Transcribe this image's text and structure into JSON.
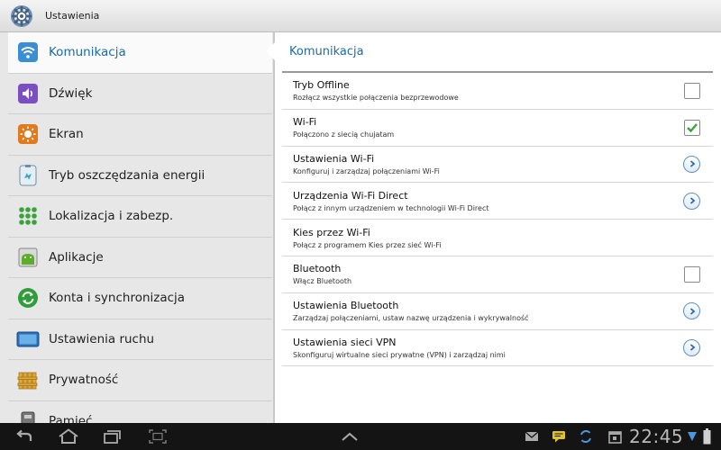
{
  "app": {
    "title": "Ustawienia",
    "icon": "settings-gear-icon"
  },
  "sidebar": {
    "items": [
      {
        "label": "Komunikacja",
        "icon": "wifi-icon",
        "active": true
      },
      {
        "label": "Dźwięk",
        "icon": "speaker-icon",
        "active": false
      },
      {
        "label": "Ekran",
        "icon": "brightness-icon",
        "active": false
      },
      {
        "label": "Tryb oszczędzania energii",
        "icon": "energy-saving-icon",
        "active": false
      },
      {
        "label": "Lokalizacja i zabezp.",
        "icon": "location-security-icon",
        "active": false
      },
      {
        "label": "Aplikacje",
        "icon": "applications-icon",
        "active": false
      },
      {
        "label": "Konta i synchronizacja",
        "icon": "sync-icon",
        "active": false
      },
      {
        "label": "Ustawienia ruchu",
        "icon": "motion-icon",
        "active": false
      },
      {
        "label": "Prywatność",
        "icon": "privacy-icon",
        "active": false
      },
      {
        "label": "Pamięć",
        "icon": "memory-icon",
        "active": false
      }
    ]
  },
  "main": {
    "section_title": "Komunikacja",
    "settings": [
      {
        "title": "Tryb Offline",
        "subtitle": "Rozłącz wszystkie połączenia bezprzewodowe",
        "control": "checkbox",
        "checked": false
      },
      {
        "title": "Wi-Fi",
        "subtitle": "Połączono z siecią chujatam",
        "control": "checkbox",
        "checked": true
      },
      {
        "title": "Ustawienia Wi-Fi",
        "subtitle": "Konfiguruj i zarządzaj połączeniami Wi-Fi",
        "control": "arrow"
      },
      {
        "title": "Urządzenia Wi-Fi Direct",
        "subtitle": "Połącz z innym urządzeniem w technologii Wi-Fi Direct",
        "control": "arrow"
      },
      {
        "title": "Kies przez Wi-Fi",
        "subtitle": "Połącz z programem Kies przez sieć Wi-Fi",
        "control": "none"
      },
      {
        "title": "Bluetooth",
        "subtitle": "Włącz Bluetooth",
        "control": "checkbox",
        "checked": false
      },
      {
        "title": "Ustawienia Bluetooth",
        "subtitle": "Zarządzaj połączeniami, ustaw nazwę urządzenia i wykrywalność",
        "control": "arrow"
      },
      {
        "title": "Ustawienia sieci VPN",
        "subtitle": "Skonfiguruj wirtualne sieci prywatne (VPN) i zarządzaj nimi",
        "control": "arrow"
      }
    ]
  },
  "system_bar": {
    "time": "22:45",
    "left_icons": [
      "back-icon",
      "home-icon",
      "recent-apps-icon",
      "screenshot-icon"
    ],
    "center_icon": "chevron-up-icon",
    "right_icons": [
      "email-icon",
      "message-icon",
      "sync-status-icon",
      "calendar-icon"
    ],
    "status_icons": [
      "wifi-signal-icon",
      "battery-icon"
    ]
  },
  "colors": {
    "accent": "#1a6ca8",
    "checkbox_check": "#3aa43a",
    "sidebar_bg": "#e7e7e7",
    "system_bar_bg": "#141414"
  }
}
